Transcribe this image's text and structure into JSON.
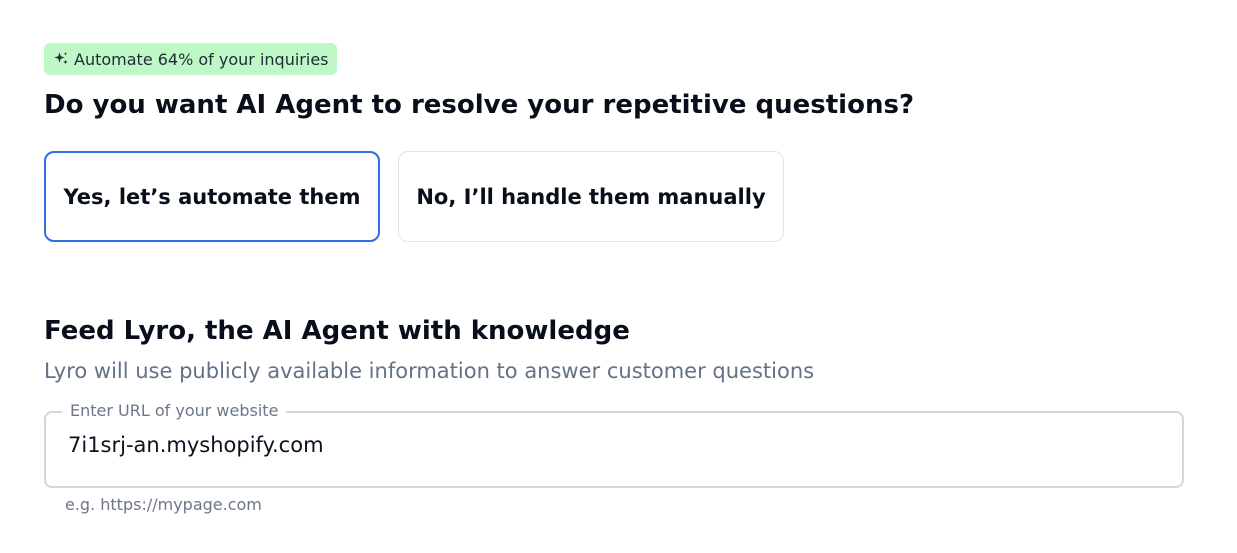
{
  "badge": {
    "icon": "sparkles-icon",
    "text": "Automate 64% of your inquiries",
    "color": "#bdf8c6"
  },
  "question": "Do you want AI Agent to resolve your repetitive questions?",
  "options": {
    "yes_label": "Yes, let’s automate them",
    "no_label": "No, I’ll handle them manually",
    "selected": "yes",
    "selected_color": "#2f6ee5"
  },
  "knowledge": {
    "title": "Feed Lyro, the AI Agent with knowledge",
    "subtitle": "Lyro will use publicly available information to answer customer questions",
    "url_label": "Enter URL of your website",
    "url_value": "7i1srj-an.myshopify.com",
    "hint": "e.g. https://mypage.com"
  }
}
